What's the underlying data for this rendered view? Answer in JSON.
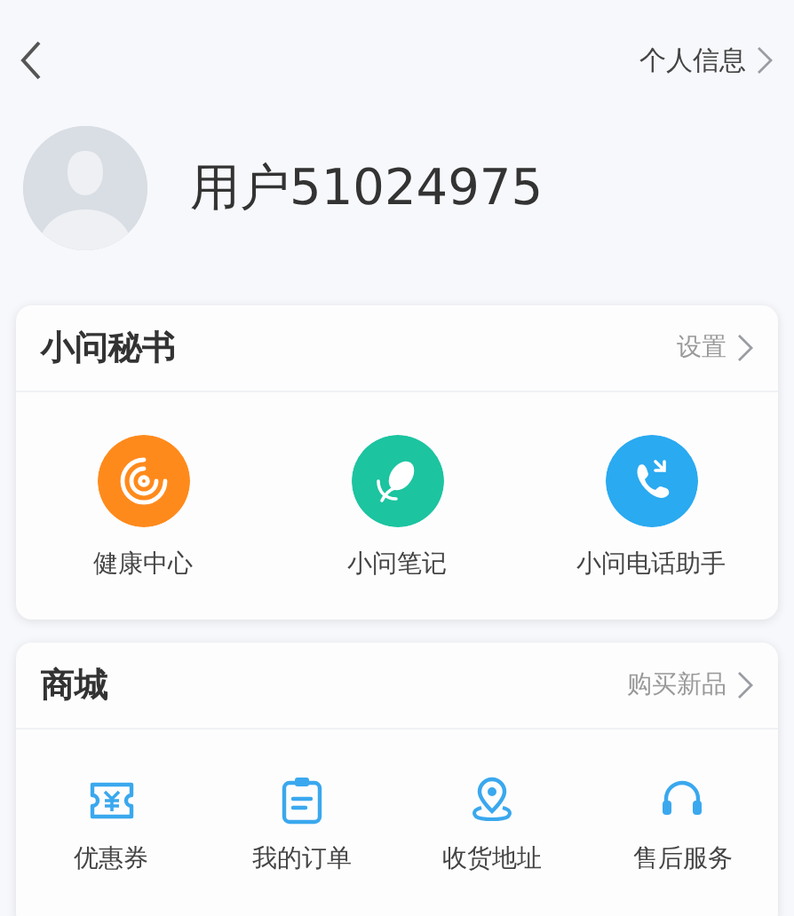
{
  "header": {
    "profile_link": "个人信息"
  },
  "user": {
    "name": "用户51024975"
  },
  "sections": [
    {
      "title": "小问秘书",
      "link": "设置",
      "items": [
        {
          "label": "健康中心",
          "kind": "health",
          "color": "#ff8a1c"
        },
        {
          "label": "小问笔记",
          "kind": "note",
          "color": "#1cc4a0"
        },
        {
          "label": "小问电话助手",
          "kind": "phone",
          "color": "#2aaaf0"
        }
      ]
    },
    {
      "title": "商城",
      "link": "购买新品",
      "items": [
        {
          "label": "优惠券",
          "kind": "coupon"
        },
        {
          "label": "我的订单",
          "kind": "order"
        },
        {
          "label": "收货地址",
          "kind": "address"
        },
        {
          "label": "售后服务",
          "kind": "service"
        }
      ]
    }
  ]
}
